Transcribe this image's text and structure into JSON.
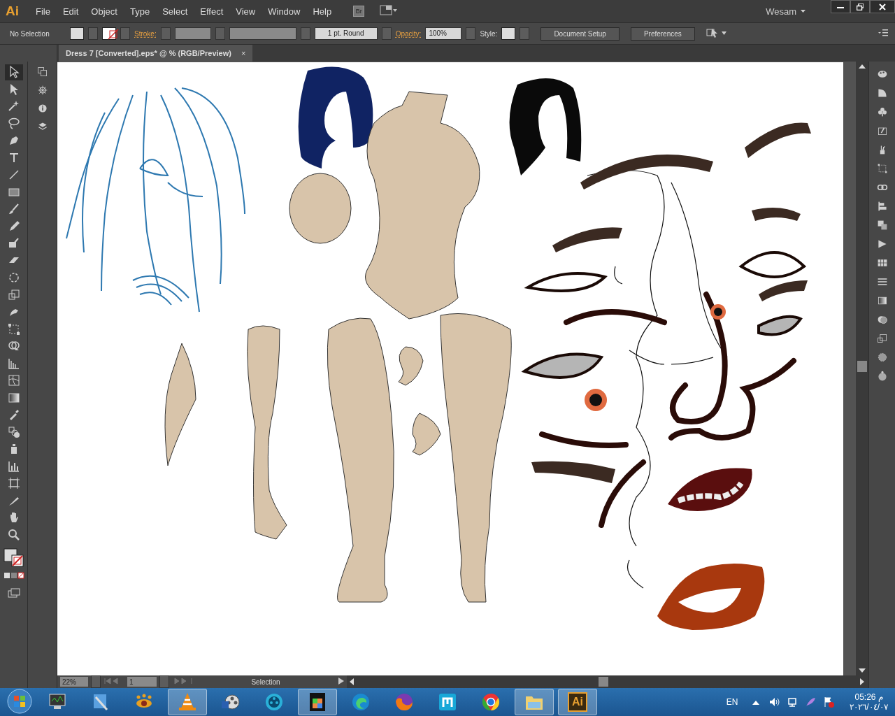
{
  "app": {
    "logo": "Ai",
    "menu": [
      "File",
      "Edit",
      "Object",
      "Type",
      "Select",
      "Effect",
      "View",
      "Window",
      "Help"
    ],
    "bridge_label": "Br",
    "workspace": "Wesam"
  },
  "control_bar": {
    "selection": "No Selection",
    "stroke_label": "Stroke:",
    "brush": "1 pt. Round",
    "opacity_label": "Opacity:",
    "opacity": "100%",
    "style_label": "Style:",
    "buttons": [
      "Document Setup",
      "Preferences"
    ]
  },
  "document_tab": {
    "title": "Dress 7 [Converted].eps* @ % (RGB/Preview)",
    "close": "×",
    "selected": true
  },
  "tools": [
    {
      "selected": true
    },
    {
      "selected": false
    },
    {
      "selected": false
    },
    {
      "selected": false
    },
    {
      "selected": false
    },
    {
      "selected": false
    },
    {
      "selected": false
    },
    {
      "selected": false
    },
    {
      "selected": false
    },
    {
      "selected": false
    },
    {
      "selected": false
    },
    {
      "selected": false
    },
    {
      "selected": false
    },
    {
      "selected": false
    },
    {
      "selected": false
    },
    {
      "selected": false
    },
    {
      "selected": false
    },
    {
      "selected": false
    },
    {
      "selected": false
    },
    {
      "selected": false
    },
    {
      "selected": false
    },
    {
      "selected": false
    },
    {
      "selected": false
    },
    {
      "selected": false
    },
    {
      "selected": false
    },
    {
      "selected": false
    },
    {
      "selected": false
    },
    {
      "selected": false
    }
  ],
  "status_bar": {
    "zoom": "22%",
    "artboard": "1",
    "tool": "Selection"
  },
  "taskbar": {
    "apps": [
      {
        "active": false
      },
      {
        "active": false
      },
      {
        "active": false
      },
      {
        "active": true
      },
      {
        "active": false
      },
      {
        "active": false
      },
      {
        "active": true
      },
      {
        "active": false
      },
      {
        "active": false
      },
      {
        "active": false
      },
      {
        "active": false
      },
      {
        "active": true
      },
      {
        "active": true,
        "label": "Ai"
      }
    ],
    "language": "EN",
    "time": "05:26 م",
    "date": "٢٠٢٦/٠٤/٠٧"
  }
}
